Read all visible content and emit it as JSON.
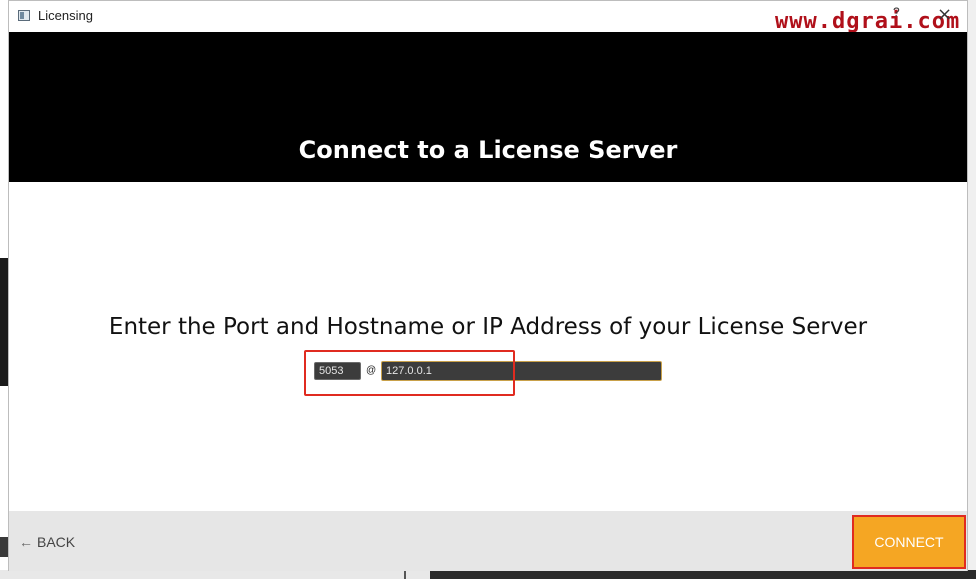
{
  "window": {
    "title": "Licensing",
    "watermark": "www.dgrai.com",
    "help_glyph": "?",
    "close_glyph": "×"
  },
  "header": {
    "title": "Connect to a License Server"
  },
  "main": {
    "prompt": "Enter the Port and Hostname or IP Address of your License Server",
    "port_value": "5053",
    "at_symbol": "@",
    "host_value": "127.0.0.1"
  },
  "footer": {
    "back_label": "BACK",
    "back_arrow": "←",
    "connect_label": "CONNECT"
  },
  "colors": {
    "header_bg": "#000000",
    "connect_bg": "#f5a623",
    "highlight": "#e02b20",
    "input_bg": "#3c3c3c"
  },
  "icons": [
    "app-icon",
    "help-icon",
    "close-icon",
    "back-arrow-icon"
  ]
}
